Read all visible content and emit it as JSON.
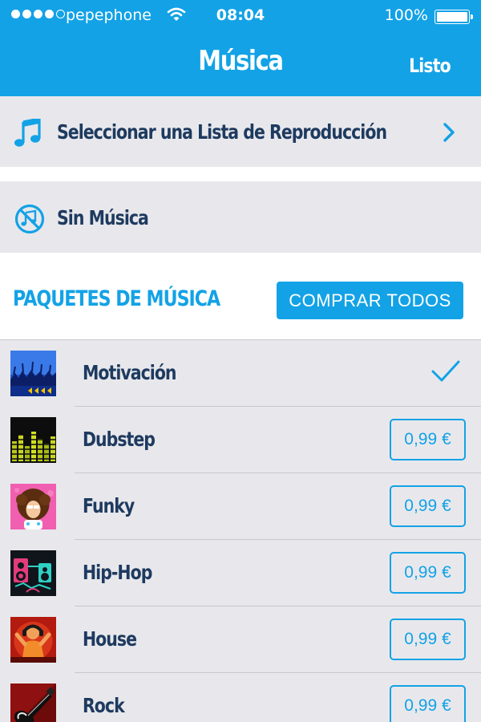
{
  "status_bar": {
    "carrier": "pepephone",
    "time": "08:04",
    "battery": "100%"
  },
  "nav": {
    "title": "Música",
    "done_label": "Listo"
  },
  "options": {
    "select_playlist": {
      "label": "Seleccionar una Lista de Reproducción",
      "icon": "music-note-icon"
    },
    "no_music": {
      "label": "Sin Música",
      "icon": "no-music-icon"
    }
  },
  "packs": {
    "title": "PAQUETES DE MÚSICA",
    "buy_all_label": "COMPRAR TODOS",
    "items": [
      {
        "name": "Motivación",
        "selected": true
      },
      {
        "name": "Dubstep",
        "price": "0,99 €"
      },
      {
        "name": "Funky",
        "price": "0,99 €"
      },
      {
        "name": "Hip-Hop",
        "price": "0,99 €"
      },
      {
        "name": "House",
        "price": "0,99 €"
      },
      {
        "name": "Rock",
        "price": "0,99 €"
      }
    ]
  },
  "colors": {
    "accent": "#13a2e6",
    "text_dark": "#1e3a5f",
    "row_bg": "#e8e8ec"
  }
}
